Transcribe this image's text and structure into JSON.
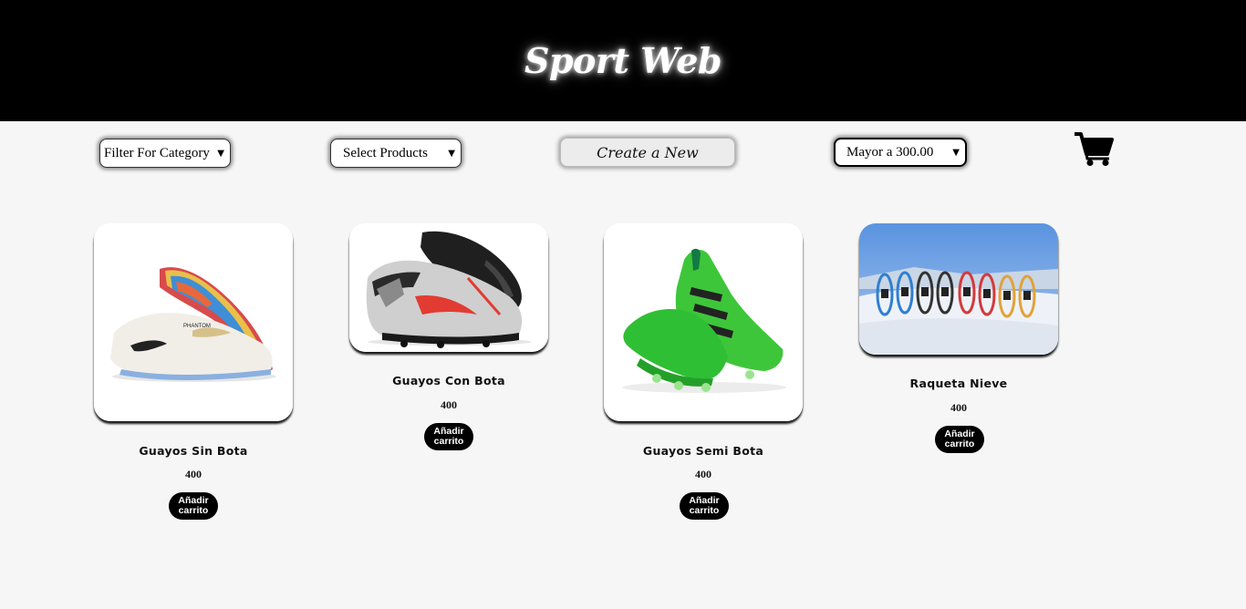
{
  "header": {
    "title": "Sport Web"
  },
  "filters": {
    "category": {
      "selected": "Filter For Category"
    },
    "products": {
      "selected": "Select Products"
    },
    "create_label": "Create a New",
    "price": {
      "selected": "Mayor a 300.00"
    }
  },
  "cart": {
    "icon": "shopping-cart-icon"
  },
  "products": [
    {
      "name": "Guayos Sin Bota",
      "price": "400",
      "button": "Añadir carrito"
    },
    {
      "name": "Guayos Con Bota",
      "price": "400",
      "button": "Añadir carrito"
    },
    {
      "name": "Guayos Semi Bota",
      "price": "400",
      "button": "Añadir carrito"
    },
    {
      "name": "Raqueta Nieve",
      "price": "400",
      "button": "Añadir carrito"
    }
  ]
}
